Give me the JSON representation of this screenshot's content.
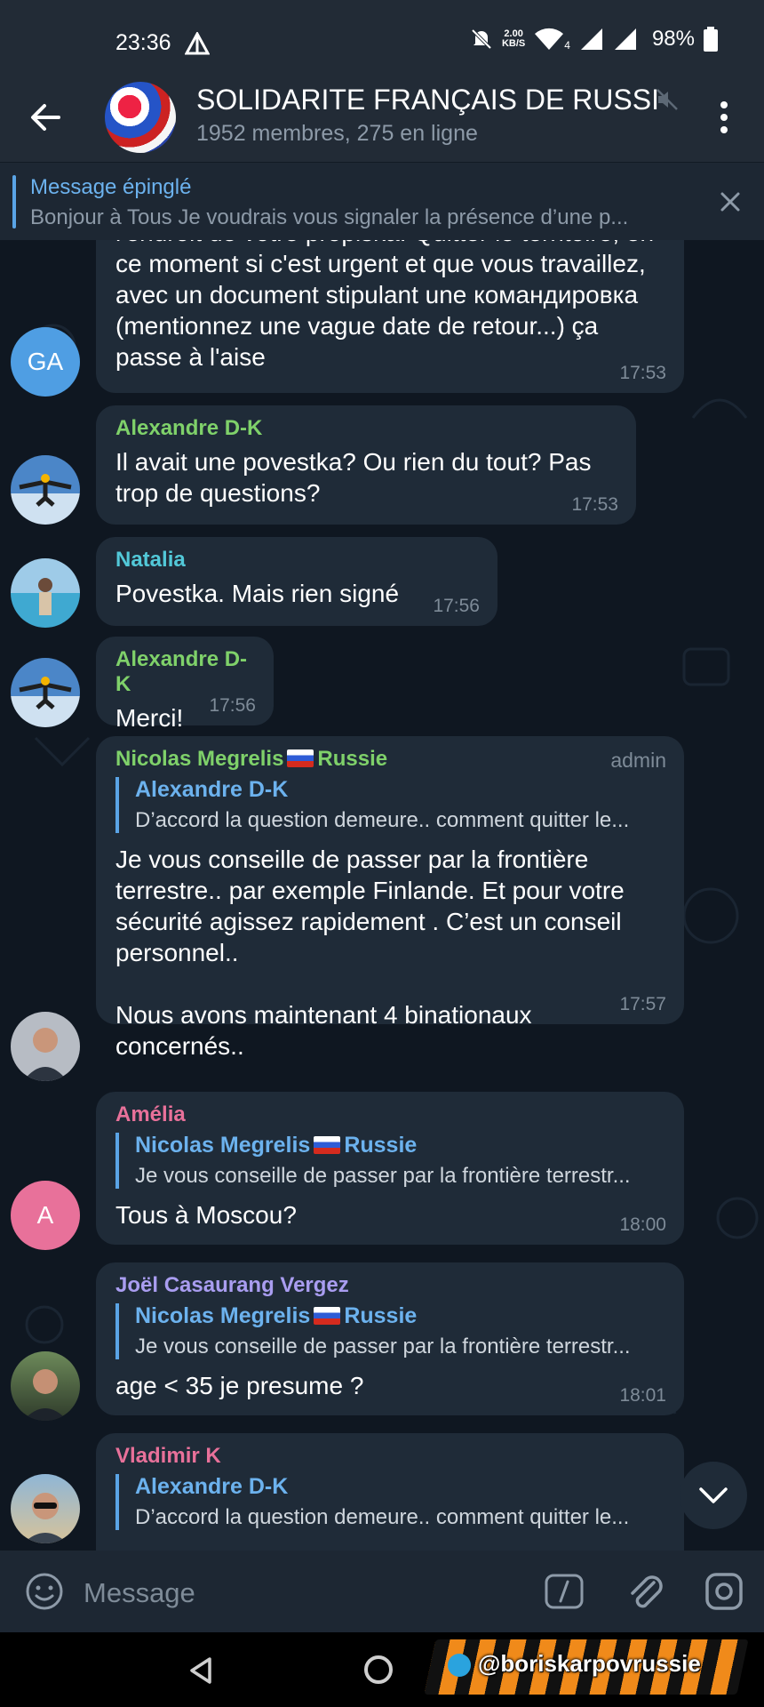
{
  "status_bar": {
    "time": "23:36",
    "net_speed_top": "2.00",
    "net_speed_bottom": "KB/S",
    "net_type": "4",
    "battery": "98%"
  },
  "header": {
    "title": "SOLIDARITE FRANÇAIS DE RUSSI",
    "subtitle": "1952 membres, 275 en ligne"
  },
  "pinned": {
    "title": "Message épinglé",
    "text": "Bonjour à Tous  Je voudrais vous signaler la présence d’une p..."
  },
  "messages": [
    {
      "text": "l'endroit de votre propiska. Quitter le territoire, en ce moment si c'est urgent et que vous travaillez, avec un document stipulant une командировка (mentionnez une vague date de retour...) ça passe à l'aise",
      "time": "17:53",
      "avatar_initials": "GA",
      "avatar_color": "#4f9ee3"
    },
    {
      "sender": "Alexandre D-K",
      "sender_color": "#7fd16a",
      "text": "Il avait une povestka? Ou rien du tout? Pas trop de questions?",
      "time": "17:53"
    },
    {
      "sender": "Natalia",
      "sender_color": "#52c8d8",
      "text": "Povestka. Mais rien signé",
      "time": "17:56"
    },
    {
      "sender": "Alexandre D-K",
      "sender_color": "#7fd16a",
      "text": "Merci!",
      "time": "17:56"
    },
    {
      "sender": "Nicolas Megrelis",
      "sender_suffix": "Russie",
      "sender_color": "#7fd16a",
      "badge": "admin",
      "reply": {
        "name": "Alexandre D-K",
        "text": "D’accord la question demeure.. comment quitter le..."
      },
      "text": "Je vous conseille de passer par la frontière terrestre.. par exemple Finlande. Et pour votre sécurité agissez rapidement . C’est un conseil personnel..\n\nNous avons maintenant 4 binationaux concernés..",
      "time": "17:57"
    },
    {
      "sender": "Amélia",
      "sender_color": "#e8719a",
      "avatar_initials": "A",
      "avatar_color": "#e8719a",
      "reply": {
        "name": "Nicolas Megrelis",
        "name_suffix": "Russie",
        "text": "Je vous conseille de passer par la frontière terrestr..."
      },
      "text": "Tous à Moscou?",
      "time": "18:00"
    },
    {
      "sender": "Joël Casaurang Vergez",
      "sender_color": "#a99df0",
      "reply": {
        "name": "Nicolas Megrelis",
        "name_suffix": "Russie",
        "text": "Je vous conseille de passer par la frontière terrestr..."
      },
      "text": "age < 35 je presume ?",
      "time": "18:01"
    },
    {
      "sender": "Vladimir K",
      "sender_color": "#e8719a",
      "reply": {
        "name": "Alexandre D-K",
        "text": "D’accord la question demeure.. comment quitter le..."
      }
    }
  ],
  "composer": {
    "placeholder": "Message"
  },
  "watermark": {
    "text": "@boriskarpovrussie"
  },
  "colors": {
    "accent": "#5aa4e6",
    "bubble": "#1f2b38",
    "background": "#0f1721",
    "header": "#222b36"
  }
}
